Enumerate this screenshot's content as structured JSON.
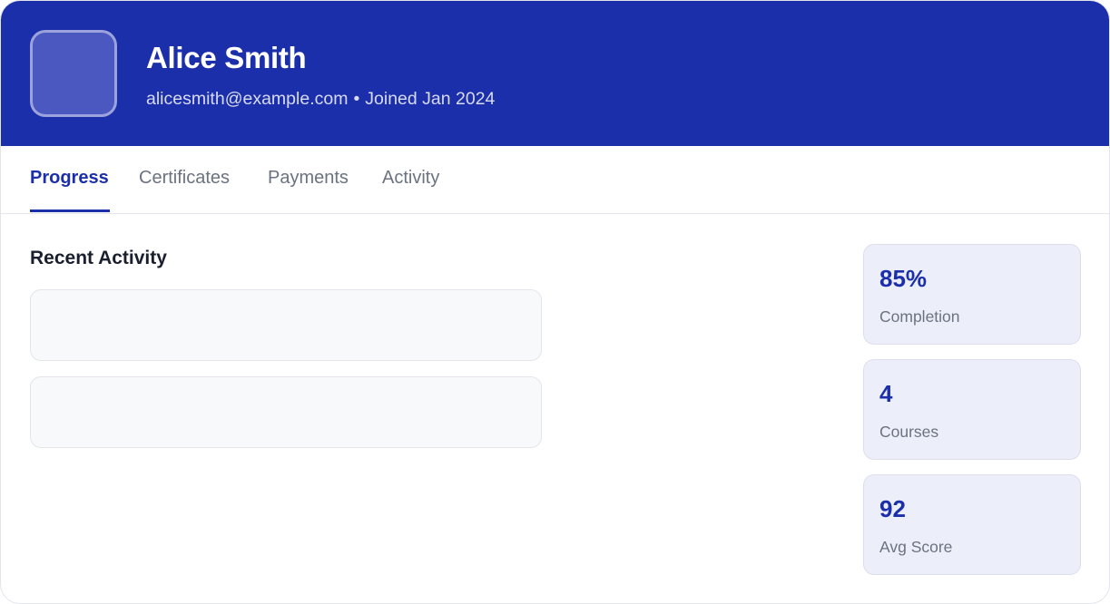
{
  "profile": {
    "name": "Alice Smith",
    "email": "alicesmith@example.com",
    "separator": "•",
    "joined": "Joined Jan 2024"
  },
  "tabs": [
    {
      "label": "Progress",
      "active": true
    },
    {
      "label": "Certificates",
      "active": false
    },
    {
      "label": "Payments",
      "active": false
    },
    {
      "label": "Activity",
      "active": false
    }
  ],
  "recent_activity": {
    "title": "Recent Activity",
    "items": [
      {},
      {}
    ]
  },
  "stats": [
    {
      "value": "85%",
      "label": "Completion"
    },
    {
      "value": "4",
      "label": "Courses"
    },
    {
      "value": "92",
      "label": "Avg Score"
    }
  ],
  "colors": {
    "accent": "#1c2faa",
    "header_bg": "#1c2faa",
    "stat_bg": "#eceffa",
    "muted_text": "#6b7280"
  }
}
